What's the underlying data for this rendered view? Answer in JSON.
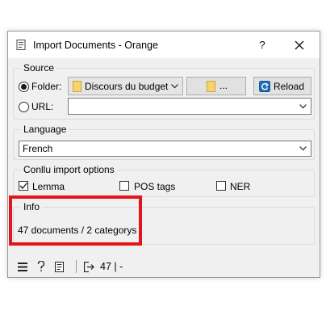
{
  "window": {
    "title": "Import Documents - Orange",
    "help_label": "?",
    "close_label": "✕"
  },
  "source": {
    "legend": "Source",
    "folder_label": "Folder:",
    "folder_selected": "Discours du budget",
    "browse_label": "...",
    "reload_label": "Reload",
    "url_label": "URL:",
    "url_value": "",
    "mode": "folder"
  },
  "language": {
    "legend": "Language",
    "selected": "French"
  },
  "conllu": {
    "legend": "Conllu import options",
    "options": [
      {
        "label": "Lemma",
        "checked": true
      },
      {
        "label": "POS tags",
        "checked": false
      },
      {
        "label": "NER",
        "checked": false
      }
    ]
  },
  "info": {
    "legend": "Info",
    "text": "47 documents / 2 categorys"
  },
  "statusbar": {
    "output_count": "47 | -"
  },
  "icons": {
    "app": "document-icon",
    "menu": "hamburger-icon",
    "help": "question-icon",
    "report": "report-icon",
    "output": "output-arrow-icon",
    "folder": "folder-icon",
    "reload": "reload-icon"
  },
  "colors": {
    "highlight": "#e0161c",
    "folder": "#f6d36b",
    "reload_accent": "#1f6fbf"
  }
}
